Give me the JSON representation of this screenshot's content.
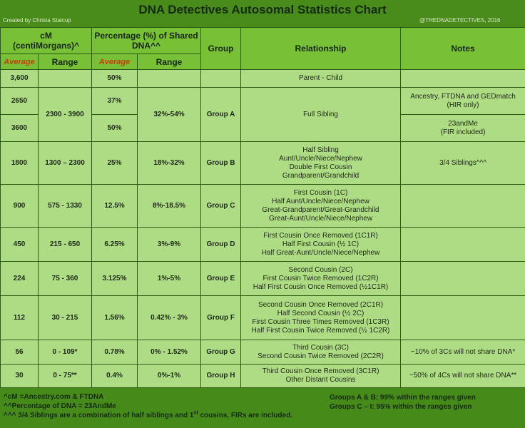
{
  "header": {
    "title": "DNA Detectives Autosomal Statistics Chart",
    "credit": "Created by Christa Stalcup",
    "copyright": "@THEDNADETECTIVES, 2016"
  },
  "columns": {
    "cm": "cM (centiMorgans)^",
    "cm_line1": "cM",
    "cm_line2": "(centiMorgans)^",
    "pct_line1": "Percentage (%) of Shared",
    "pct_line2": "DNA^^",
    "group": "Group",
    "relationship": "Relationship",
    "notes": "Notes",
    "average": "Average",
    "range": "Range"
  },
  "rows": {
    "parent": {
      "cm_avg": "3,600",
      "pct_avg": "50%",
      "relationship": "Parent - Child"
    },
    "full_sibling": {
      "cm_avg_1": "2650",
      "cm_avg_2": "3600",
      "cm_range": "2300 - 3900",
      "pct_avg_1": "37%",
      "pct_avg_2": "50%",
      "pct_range": "32%-54%",
      "group": "Group A",
      "relationship": "Full Sibling",
      "note_1_line1": "Ancestry, FTDNA and GEDmatch",
      "note_1_line2": "(HIR only)",
      "note_2_line1": "23andMe",
      "note_2_line2": "(FIR included)"
    },
    "group_b": {
      "cm_avg": "1800",
      "cm_range": "1300 – 2300",
      "pct_avg": "25%",
      "pct_range": "18%-32%",
      "group": "Group B",
      "relationships": [
        "Half Sibling",
        "Aunt/Uncle/Niece/Nephew",
        "Double First Cousin",
        "Grandparent/Grandchild"
      ],
      "note": "3/4 Siblings^^^"
    },
    "group_c": {
      "cm_avg": "900",
      "cm_range": "575 - 1330",
      "pct_avg": "12.5%",
      "pct_range": "8%-18.5%",
      "group": "Group C",
      "relationships": [
        "First Cousin (1C)",
        "Half Aunt/Uncle/Niece/Nephew",
        "Great-Grandparent/Great-Grandchild",
        "Great-Aunt/Uncle/Niece/Nephew"
      ]
    },
    "group_d": {
      "cm_avg": "450",
      "cm_range": "215 - 650",
      "pct_avg": "6.25%",
      "pct_range": "3%-9%",
      "group": "Group D",
      "relationships": [
        "First Cousin Once Removed (1C1R)",
        "Half First Cousin (½ 1C)",
        "Half Great-Aunt/Uncle/Niece/Nephew"
      ]
    },
    "group_e": {
      "cm_avg": "224",
      "cm_range": "75 - 360",
      "pct_avg": "3.125%",
      "pct_range": "1%-5%",
      "group": "Group E",
      "relationships": [
        "Second Cousin (2C)",
        "First Cousin Twice Removed (1C2R)",
        "Half First Cousin Once Removed (½1C1R)"
      ]
    },
    "group_f": {
      "cm_avg": "112",
      "cm_range": "30 - 215",
      "pct_avg": "1.56%",
      "pct_range": "0.42% - 3%",
      "group": "Group F",
      "relationships": [
        "Second Cousin Once Removed (2C1R)",
        "Half Second Cousin (½ 2C)",
        "First Cousin Three Times Removed (1C3R)",
        "Half First Cousin Twice Removed (½ 1C2R)"
      ]
    },
    "group_g": {
      "cm_avg": "56",
      "cm_range": "0 - 109*",
      "pct_avg": "0.78%",
      "pct_range": "0% - 1.52%",
      "group": "Group G",
      "relationships": [
        "Third Cousin (3C)",
        "Second Cousin Twice Removed (2C2R)"
      ],
      "note": "~10% of 3Cs will not share DNA*"
    },
    "group_h": {
      "cm_avg": "30",
      "cm_range": "0 - 75**",
      "pct_avg": "0.4%",
      "pct_range": "0%-1%",
      "group": "Group H",
      "relationships": [
        "Third Cousin Once Removed (3C1R)",
        "Other Distant Cousins"
      ],
      "note": "~50% of 4Cs will not share DNA**"
    }
  },
  "footer": {
    "left": [
      "^cM =Ancestry.com  & FTDNA",
      "^^Percentage of DNA = 23AndMe"
    ],
    "left_3_pre": "^^^ 3/4 Siblings are a combination of half siblings and 1",
    "left_3_sup": "st",
    "left_3_post": " cousins, FIRs are included.",
    "right": [
      "Groups A & B: 99%  within the ranges given",
      "Groups C – I: 95%  within the ranges given"
    ]
  },
  "colors": {
    "frame": "#468a1a",
    "header_cell": "#78c035",
    "body_cell": "#aedc84",
    "average_text": "#b3440f",
    "border": "#2c5a12"
  }
}
